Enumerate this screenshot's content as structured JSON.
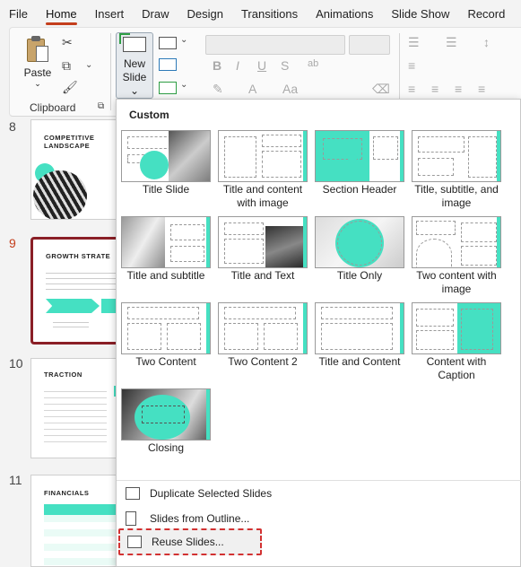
{
  "tabs": [
    "File",
    "Home",
    "Insert",
    "Draw",
    "Design",
    "Transitions",
    "Animations",
    "Slide Show",
    "Record"
  ],
  "active_tab": "Home",
  "ribbon": {
    "paste_label": "Paste",
    "clipboard_label": "Clipboard",
    "new_slide_label_1": "New",
    "new_slide_label_2": "Slide"
  },
  "slides": [
    {
      "number": "8",
      "title": "COMPETITIVE LANDSCAPE"
    },
    {
      "number": "9",
      "title": "GROWTH STRATE"
    },
    {
      "number": "10",
      "title": "TRACTION"
    },
    {
      "number": "11",
      "title": "FINANCIALS"
    }
  ],
  "dropdown": {
    "header": "Custom",
    "layouts": [
      "Title Slide",
      "Title and content with image",
      "Section Header",
      "Title, subtitle, and image",
      "Title and subtitle",
      "Title and Text",
      "Title Only",
      "Two content with image",
      "Two Content",
      "Two Content 2",
      "Title and Content",
      "Content with Caption",
      "Closing"
    ],
    "menu": {
      "duplicate": "Duplicate Selected Slides",
      "outline": "Slides from Outline...",
      "reuse": "Reuse Slides..."
    }
  },
  "colors": {
    "accent": "#c43e1c",
    "teal": "#45e0c2",
    "selection": "#8a1f26"
  }
}
